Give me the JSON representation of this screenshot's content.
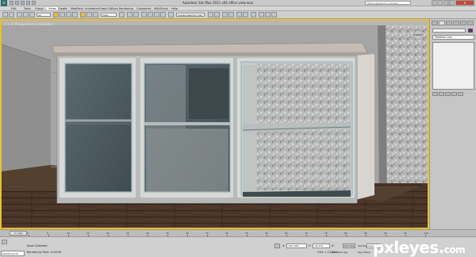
{
  "app": {
    "logo": "G",
    "title": "Autodesk 3ds Max  2011 x64    office view.max",
    "search_placeholder": "Type a keyword or phrase"
  },
  "menu": [
    "Edit",
    "Tools",
    "Group",
    "Views",
    "Create",
    "Modifiers",
    "Animation",
    "Graph Editors",
    "Rendering",
    "Customize",
    "MAXScript",
    "Help"
  ],
  "toolbar": {
    "selection_filter": "All",
    "view_dropdown": "View",
    "named_selection": "Create Selection Set"
  },
  "viewport": {
    "label": "[ + ] [ Perspective ] [ Realistic ]",
    "viewcube": "FRONT"
  },
  "command_panel": {
    "modifier_list": "Modifier List"
  },
  "timeline": {
    "frame_indicator": "0 / 100",
    "ticks": [
      "0",
      "5",
      "10",
      "15",
      "20",
      "25",
      "30",
      "35",
      "40",
      "45",
      "50",
      "55",
      "60",
      "65",
      "70",
      "75",
      "80",
      "85",
      "90",
      "95",
      "100"
    ]
  },
  "status": {
    "maxscript_listener": "MAXScript Mi",
    "selection": "None Selected",
    "render_time": "Rendering Time: 0:00:00",
    "x_label": "X:",
    "x_value": "-697.483",
    "y_label": "Y:",
    "y_value": "-95.631",
    "z_label": "Z:",
    "z_value": "0.0",
    "grid": "Grid = 0.254m",
    "add_time_tag": "Add Time Tag",
    "auto_key": "Auto Key",
    "set_key": "Set Key",
    "selected": "Selected",
    "key_filters": "Key Filters..."
  },
  "watermark": {
    "brand": "pxleyes",
    "dot": ".",
    "tld": "com"
  },
  "colors": {
    "viewport_border": "#e6c32a",
    "wall": "#a3a3a3",
    "floor": "#4c372b",
    "cabinet_frame": "#cfd2d0",
    "glass": "#4f5e63"
  }
}
